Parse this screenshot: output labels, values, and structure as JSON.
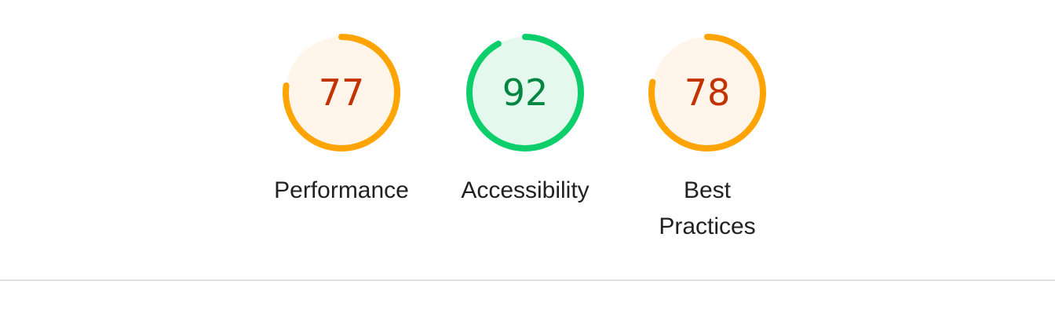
{
  "colors": {
    "average_stroke": "#ffa400",
    "average_fill": "#fff5ea",
    "average_text": "#c33300",
    "pass_stroke": "#0cce6b",
    "pass_fill": "#e5f8ee",
    "pass_text": "#018642",
    "divider": "#e0e0e0"
  },
  "gauges": [
    {
      "label": "Performance",
      "score": "77",
      "fraction": 0.77,
      "rating": "average"
    },
    {
      "label": "Accessibility",
      "score": "92",
      "fraction": 0.92,
      "rating": "pass"
    },
    {
      "label": "Best Practices",
      "score": "78",
      "fraction": 0.78,
      "rating": "average"
    }
  ]
}
